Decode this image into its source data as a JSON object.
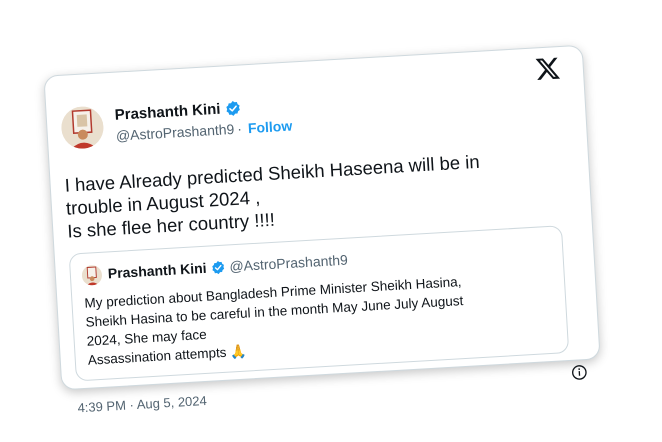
{
  "tweet": {
    "author_name": "Prashanth Kini",
    "handle": "@AstroPrashanth9",
    "separator": "·",
    "follow_label": "Follow",
    "text": "I have Already predicted Sheikh Haseena will be in\ntrouble in August 2024 ,\nIs she flee her country !!!!",
    "timestamp": "4:39 PM · Aug 5, 2024"
  },
  "quoted": {
    "author_name": "Prashanth Kini",
    "handle": "@AstroPrashanth9",
    "text": "My prediction about Bangladesh Prime Minister Sheikh Hasina,\nSheikh Hasina to be careful in the month May June July August\n2024, She may face\nAssassination attempts 🙏"
  },
  "icons": {
    "brand": "x-logo-icon",
    "verified": "verified-badge-icon",
    "info": "info-icon"
  },
  "colors": {
    "accent": "#1d9bf0",
    "text": "#0f1419",
    "muted": "#536471",
    "border": "#cfd9de"
  }
}
